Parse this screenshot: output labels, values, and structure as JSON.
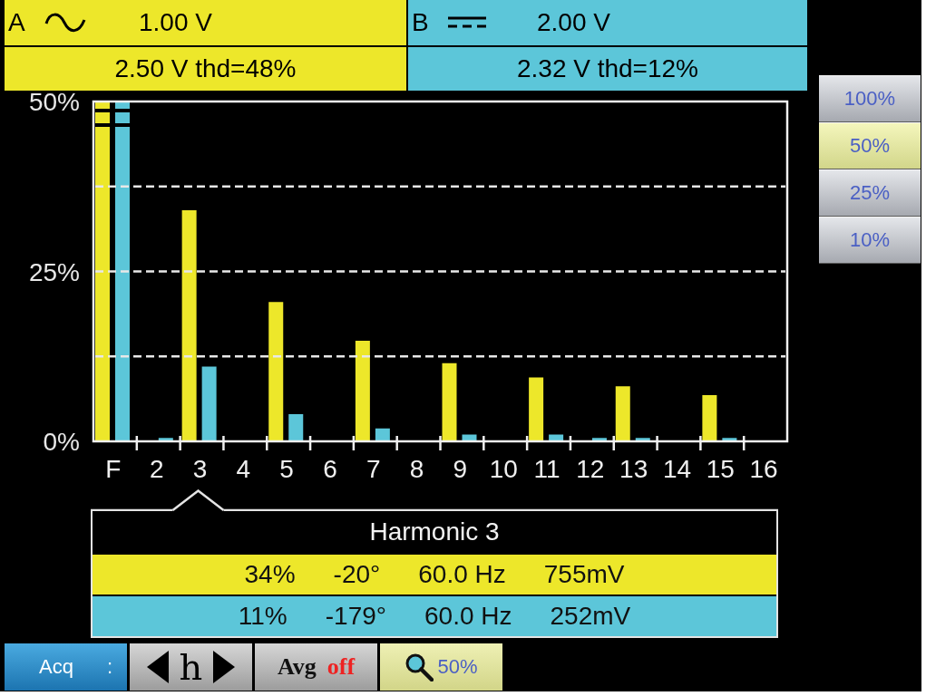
{
  "channels": [
    {
      "name": "A",
      "kind": "ac",
      "scale": "1.00 V",
      "reading": "2.50 V thd=48%",
      "color": "#ede72a"
    },
    {
      "name": "B",
      "kind": "dc",
      "scale": "2.00 V",
      "reading": "2.32 V thd=12%",
      "color": "#5cc6d9"
    }
  ],
  "spectrum": {
    "chart_data": {
      "type": "bar",
      "categories": [
        "F",
        "2",
        "3",
        "4",
        "5",
        "6",
        "7",
        "8",
        "9",
        "10",
        "11",
        "12",
        "13",
        "14",
        "15",
        "16"
      ],
      "ylim": [
        0,
        50
      ],
      "yticks": [
        {
          "value": 0,
          "label": "0%"
        },
        {
          "value": 25,
          "label": "25%"
        },
        {
          "value": 50,
          "label": "50%"
        }
      ],
      "grid": true,
      "series": [
        {
          "color": "#ede72a",
          "values": [
            50,
            0,
            34,
            0,
            20.5,
            0,
            14.8,
            0,
            11.5,
            0,
            9.4,
            0,
            8.1,
            0,
            6.8,
            0
          ]
        },
        {
          "color": "#5cc6d9",
          "values": [
            50,
            0.5,
            11,
            0,
            4,
            0,
            1.9,
            0,
            1,
            0,
            1,
            0.5,
            0.5,
            0,
            0.5,
            0
          ]
        }
      ]
    }
  },
  "harmonic_detail": {
    "pointer": [
      false,
      false,
      true,
      false,
      false,
      false,
      false,
      false,
      false,
      false,
      false,
      false,
      false,
      false,
      false,
      false
    ],
    "title": "Harmonic 3",
    "rows": [
      {
        "color": "#ede72a",
        "cells": [
          "34%",
          "-20°",
          "60.0 Hz",
          "755mV"
        ]
      },
      {
        "color": "#5cc6d9",
        "cells": [
          "11%",
          "-179°",
          "60.0 Hz",
          "252mV"
        ]
      }
    ]
  },
  "zoom_menu": [
    {
      "label": "100%",
      "selected": false
    },
    {
      "label": "50%",
      "selected": true
    },
    {
      "label": "25%",
      "selected": false
    },
    {
      "label": "10%",
      "selected": false
    }
  ],
  "toolbar": [
    {
      "kind": "menu",
      "label": "Acq",
      "suffix": ":"
    },
    {
      "kind": "stepper",
      "label": "h"
    },
    {
      "kind": "toggle",
      "label": "Avg",
      "value": "off",
      "on": false
    },
    {
      "kind": "zoom",
      "label": "50%"
    }
  ]
}
